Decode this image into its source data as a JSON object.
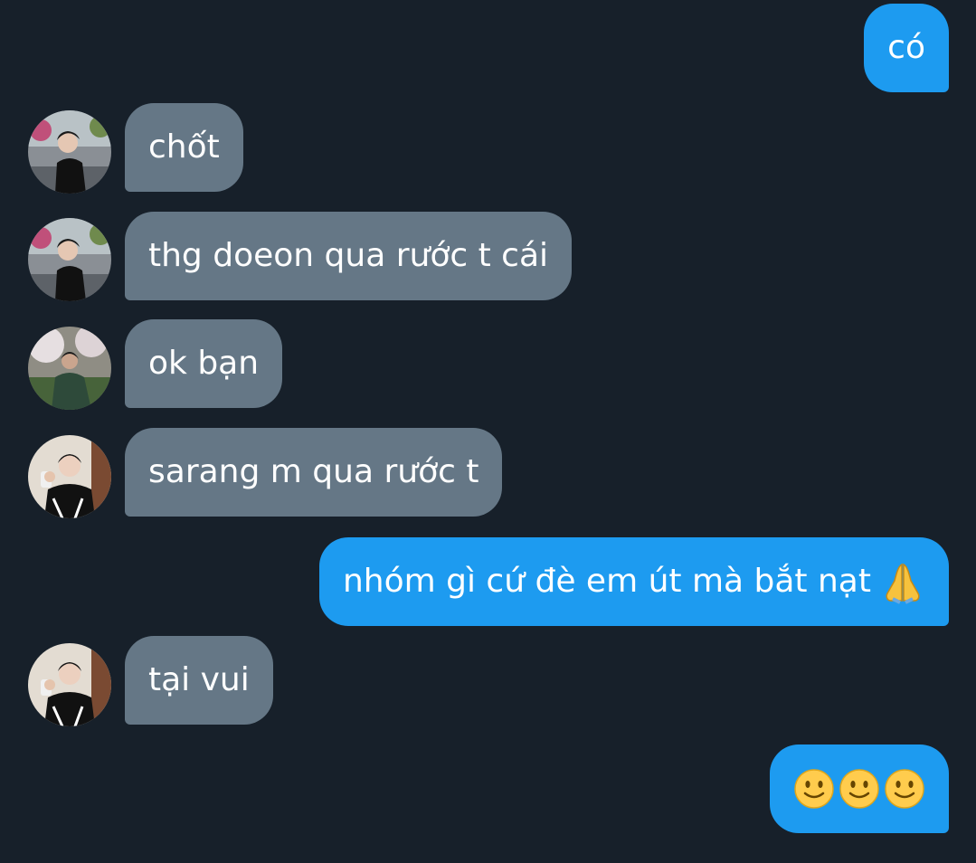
{
  "colors": {
    "background": "#17202a",
    "incoming_bubble": "#657786",
    "outgoing_bubble": "#1d9bf0",
    "text": "#ffffff"
  },
  "messages": [
    {
      "direction": "out",
      "text": "có"
    },
    {
      "direction": "in",
      "text": "chốt",
      "avatar": "avatar-a-icon"
    },
    {
      "direction": "in",
      "text": "thg doeon qua rước t cái",
      "avatar": "avatar-a-icon"
    },
    {
      "direction": "in",
      "text": "ok bạn",
      "avatar": "avatar-b-icon"
    },
    {
      "direction": "in",
      "text": "sarang m qua rước t",
      "avatar": "avatar-c-icon"
    },
    {
      "direction": "out",
      "text": "nhóm gì cứ đè em út mà bắt nạt",
      "emoji": "folded-hands-icon"
    },
    {
      "direction": "in",
      "text": "tại vui",
      "avatar": "avatar-c-icon"
    },
    {
      "direction": "out",
      "text": "",
      "emoji": "slightly-smiling-face-icon x3"
    }
  ]
}
